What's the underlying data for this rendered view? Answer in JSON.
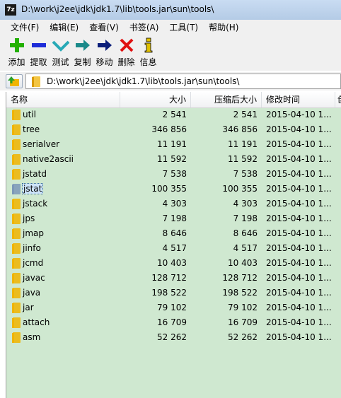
{
  "window": {
    "app_icon_text": "7z",
    "title": "D:\\work\\j2ee\\jdk\\jdk1.7\\lib\\tools.jar\\sun\\tools\\"
  },
  "menu": [
    {
      "label": "文件(F)"
    },
    {
      "label": "编辑(E)"
    },
    {
      "label": "查看(V)"
    },
    {
      "label": "书签(A)"
    },
    {
      "label": "工具(T)"
    },
    {
      "label": "帮助(H)"
    }
  ],
  "toolbar": [
    {
      "label": "添加",
      "icon": "plus-icon",
      "color": "#22b000"
    },
    {
      "label": "提取",
      "icon": "minus-icon",
      "color": "#1e2cd8"
    },
    {
      "label": "测试",
      "icon": "check-icon",
      "color": "#27a9b6"
    },
    {
      "label": "复制",
      "icon": "copy-arrow-icon",
      "color": "#1a8a8a"
    },
    {
      "label": "移动",
      "icon": "move-arrow-icon",
      "color": "#0b1e7a"
    },
    {
      "label": "删除",
      "icon": "delete-x-icon",
      "color": "#e01010"
    },
    {
      "label": "信息",
      "icon": "info-icon",
      "color": "#e0c000"
    }
  ],
  "address": {
    "path": "D:\\work\\j2ee\\jdk\\jdk1.7\\lib\\tools.jar\\sun\\tools\\"
  },
  "columns": {
    "name": "名称",
    "size": "大小",
    "packed": "压缩后大小",
    "mtime": "修改时间",
    "extra": "创"
  },
  "files": [
    {
      "name": "util",
      "size": "2 541",
      "packed": "2 541",
      "mtime": "2015-04-10 1...",
      "selected": false
    },
    {
      "name": "tree",
      "size": "346 856",
      "packed": "346 856",
      "mtime": "2015-04-10 1...",
      "selected": false
    },
    {
      "name": "serialver",
      "size": "11 191",
      "packed": "11 191",
      "mtime": "2015-04-10 1...",
      "selected": false
    },
    {
      "name": "native2ascii",
      "size": "11 592",
      "packed": "11 592",
      "mtime": "2015-04-10 1...",
      "selected": false
    },
    {
      "name": "jstatd",
      "size": "7 538",
      "packed": "7 538",
      "mtime": "2015-04-10 1...",
      "selected": false
    },
    {
      "name": "jstat",
      "size": "100 355",
      "packed": "100 355",
      "mtime": "2015-04-10 1...",
      "selected": true
    },
    {
      "name": "jstack",
      "size": "4 303",
      "packed": "4 303",
      "mtime": "2015-04-10 1...",
      "selected": false
    },
    {
      "name": "jps",
      "size": "7 198",
      "packed": "7 198",
      "mtime": "2015-04-10 1...",
      "selected": false
    },
    {
      "name": "jmap",
      "size": "8 646",
      "packed": "8 646",
      "mtime": "2015-04-10 1...",
      "selected": false
    },
    {
      "name": "jinfo",
      "size": "4 517",
      "packed": "4 517",
      "mtime": "2015-04-10 1...",
      "selected": false
    },
    {
      "name": "jcmd",
      "size": "10 403",
      "packed": "10 403",
      "mtime": "2015-04-10 1...",
      "selected": false
    },
    {
      "name": "javac",
      "size": "128 712",
      "packed": "128 712",
      "mtime": "2015-04-10 1...",
      "selected": false
    },
    {
      "name": "java",
      "size": "198 522",
      "packed": "198 522",
      "mtime": "2015-04-10 1...",
      "selected": false
    },
    {
      "name": "jar",
      "size": "79 102",
      "packed": "79 102",
      "mtime": "2015-04-10 1...",
      "selected": false
    },
    {
      "name": "attach",
      "size": "16 709",
      "packed": "16 709",
      "mtime": "2015-04-10 1...",
      "selected": false
    },
    {
      "name": "asm",
      "size": "52 262",
      "packed": "52 262",
      "mtime": "2015-04-10 1...",
      "selected": false
    }
  ],
  "colors": {
    "list_background": "#cfe8d0",
    "folder": "#f0b400",
    "selected_folder": "#7b97b8"
  }
}
